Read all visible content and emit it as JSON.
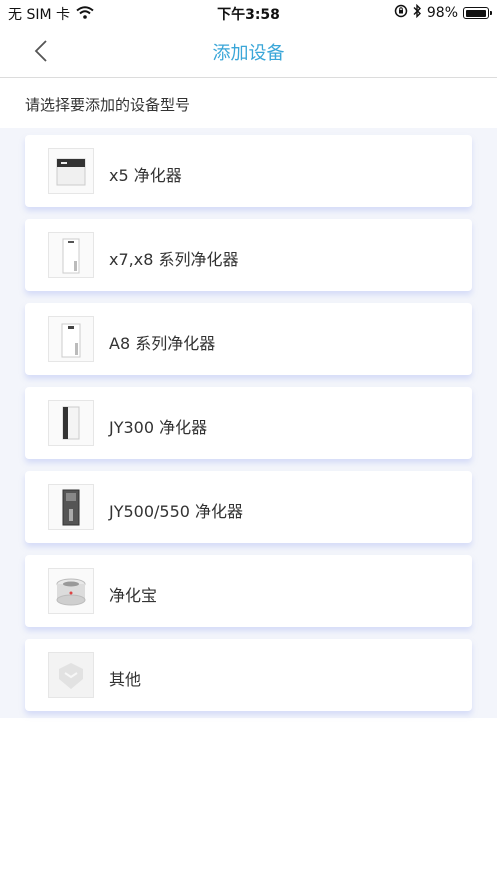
{
  "status_bar": {
    "carrier": "无 SIM 卡",
    "time": "下午3:58",
    "battery": "98%",
    "battery_level": 0.98
  },
  "nav": {
    "title": "添加设备",
    "back_icon": "chevron-left-icon"
  },
  "section_label": "请选择要添加的设备型号",
  "colors": {
    "accent": "#3aa6d8",
    "list_background": "#f3f5fb"
  },
  "devices": [
    {
      "label": "x5 净化器",
      "icon": "x5-purifier-image"
    },
    {
      "label": "x7,x8 系列净化器",
      "icon": "x7-x8-purifier-image"
    },
    {
      "label": "A8 系列净化器",
      "icon": "a8-purifier-image"
    },
    {
      "label": "JY300 净化器",
      "icon": "jy300-purifier-image"
    },
    {
      "label": "JY500/550 净化器",
      "icon": "jy500-purifier-image"
    },
    {
      "label": "净化宝",
      "icon": "purifier-bao-image"
    },
    {
      "label": "其他",
      "icon": "other-device-icon"
    }
  ]
}
